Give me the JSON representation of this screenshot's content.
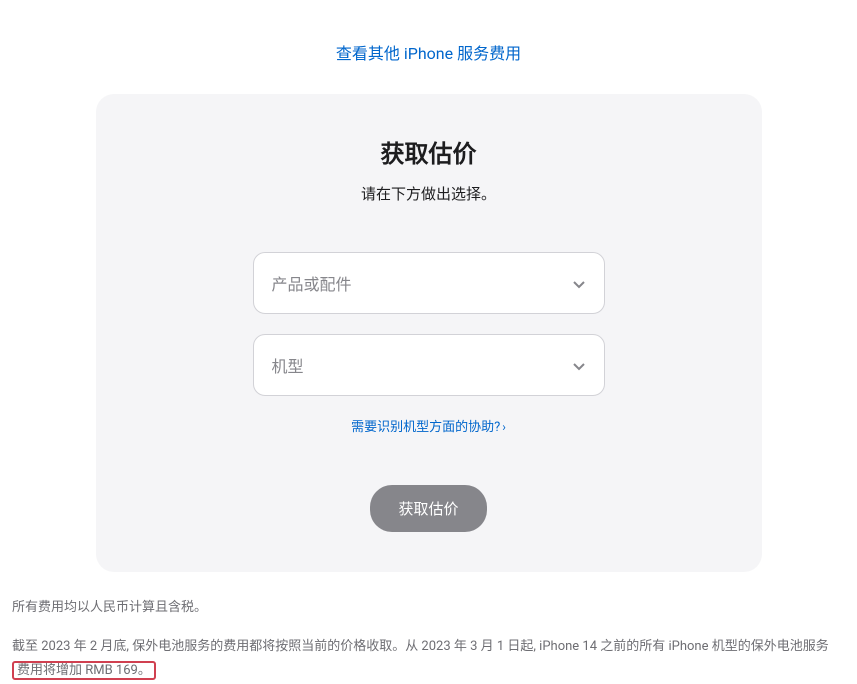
{
  "topLink": {
    "label": "查看其他 iPhone 服务费用"
  },
  "card": {
    "title": "获取估价",
    "subtitle": "请在下方做出选择。",
    "select1": {
      "placeholder": "产品或配件"
    },
    "select2": {
      "placeholder": "机型"
    },
    "helpLink": {
      "label": "需要识别机型方面的协助?"
    },
    "button": {
      "label": "获取估价"
    }
  },
  "footer": {
    "line1": "所有费用均以人民币计算且含税。",
    "line2_pre": "截至 2023 年 2 月底, 保外电池服务的费用都将按照当前的价格收取。从 2023 年 3 月 1 日起, iPhone 14 之前的所有 iPhone 机型的保外电池服务",
    "line2_highlight": "费用将增加 RMB 169。"
  }
}
